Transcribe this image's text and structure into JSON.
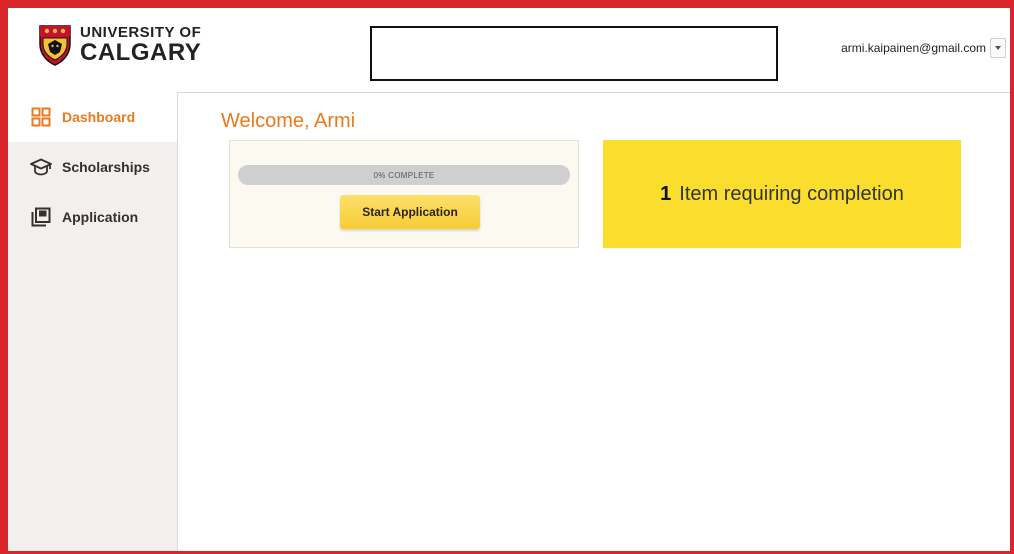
{
  "header": {
    "logo": {
      "line1": "UNIVERSITY OF",
      "line2": "CALGARY"
    },
    "user_email": "armi.kaipainen@gmail.com"
  },
  "sidebar": {
    "items": [
      {
        "label": "Dashboard",
        "icon": "dashboard-icon",
        "active": true
      },
      {
        "label": "Scholarships",
        "icon": "graduation-cap-icon",
        "active": false
      },
      {
        "label": "Application",
        "icon": "application-icon",
        "active": false
      }
    ]
  },
  "main": {
    "welcome": "Welcome, Armi",
    "progress": {
      "percent": 0,
      "label": "0% COMPLETE",
      "button_label": "Start Application"
    },
    "completion": {
      "count": "1",
      "text": "Item requiring completion"
    }
  },
  "colors": {
    "frame": "#d8262b",
    "accent": "#e97a1f",
    "yellow_card": "#fbde2d",
    "button": "#f7cc35",
    "sidebar_bg": "#f1f0ee"
  }
}
